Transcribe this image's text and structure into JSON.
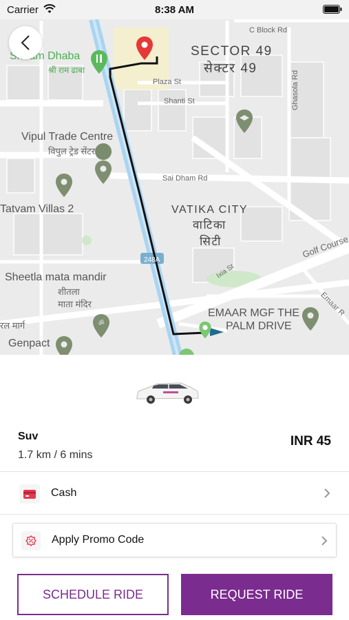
{
  "status_bar": {
    "carrier": "Carrier",
    "time": "8:38 AM",
    "wifi_icon": "wifi-icon",
    "battery_icon": "battery-full-icon"
  },
  "map": {
    "back_icon": "chevron-left-icon",
    "labels": {
      "sector_en": "SECTOR 49",
      "sector_hi": "सेक्टर 49",
      "c_block": "C Block Rd",
      "plaza": "Plaza St",
      "shanti": "Shanti St",
      "ghasola": "Ghasola Rd",
      "sai_dham": "Sai Dham Rd",
      "dhaba_en": "Shiram Dhaba",
      "dhaba_hi": "श्री राम ढाबा",
      "vipul_en": "Vipul Trade Centre",
      "vipul_hi": "विपुल ट्रेड सेंटर",
      "tatvam": "Tatvam Villas 2",
      "vatika_en": "VATIKA CITY",
      "vatika_hi1": "वाटिका",
      "vatika_hi2": "सिटी",
      "hw_248a": "248A",
      "golf": "Golf Course",
      "ixia": "Ixia St",
      "sheetla_en": "Sheetla mata mandir",
      "sheetla_hi1": "शीतला",
      "sheetla_hi2": "माता मंदिर",
      "emaar1": "EMAAR MGF THE",
      "emaar2": "PALM DRIVE",
      "emaar_road": "Emaar R",
      "marg": "रल मार्ग",
      "genpact": "Genpact"
    }
  },
  "ride": {
    "car_icon": "suv-car-image",
    "type": "Suv",
    "distance": "1.7 km / 6 mins",
    "price": "INR 45"
  },
  "payment": {
    "icon": "credit-card-icon",
    "label": "Cash"
  },
  "promo": {
    "icon": "discount-badge-icon",
    "label": "Apply Promo Code"
  },
  "actions": {
    "schedule_label": "SCHEDULE RIDE",
    "request_label": "REQUEST RIDE"
  },
  "colors": {
    "accent": "#7b2c8f",
    "route": "#111111",
    "canal": "#a9d4f2",
    "map_bg": "#ececec"
  }
}
